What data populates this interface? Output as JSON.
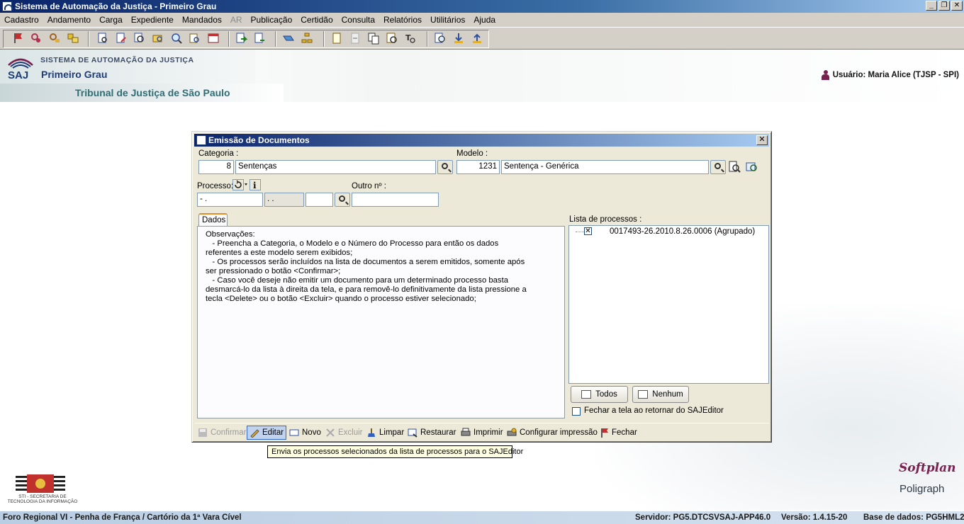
{
  "window": {
    "title": "Sistema de Automação da Justiça - Primeiro Grau",
    "min_glyph": "_",
    "restore_glyph": "❐",
    "close_glyph": "✕"
  },
  "menu": [
    "Cadastro",
    "Andamento",
    "Carga",
    "Expediente",
    "Mandados",
    "AR",
    "Publicação",
    "Certidão",
    "Consulta",
    "Relatórios",
    "Utilitários",
    "Ajuda"
  ],
  "header": {
    "logo_text": "SAJ",
    "system_name": "SISTEMA DE AUTOMAÇÃO DA JUSTIÇA",
    "grau": "Primeiro Grau",
    "tribunal": "Tribunal de Justiça de São Paulo",
    "usuario": "Usuário: Maria Alice (TJSP - SPI)"
  },
  "dialog": {
    "title": "Emissão de Documentos",
    "close_glyph": "✕",
    "categoria": {
      "label": "Categoria :",
      "code": "8",
      "name": "Sentenças"
    },
    "modelo": {
      "label": "Modelo :",
      "code": "1231",
      "name": "Sentença - Genérica"
    },
    "processo": {
      "label": "Processo:",
      "part1": "     -  .",
      "part2": " .  .",
      "part3": ""
    },
    "outro": {
      "label": "Outro nº :",
      "value": ""
    },
    "tab_label": "Dados",
    "observacoes": "Observações:\n   - Preencha a Categoria, o Modelo e o Número do Processo para então os dados\nreferentes a este modelo serem exibidos;\n   - Os processos serão incluídos na lista de documentos a serem emitidos, somente após\nser pressionado o botão <Confirmar>;\n   - Caso você deseje não emitir um documento para um determinado processo basta\ndesmarcá-lo da lista à direita da tela, e para removê-lo definitivamente da lista pressione a\ntecla <Delete> ou o botão <Excluir> quando o processo estiver selecionado;",
    "lista_label": "Lista de processos :",
    "lista_items": [
      {
        "text": "0017493-26.2010.8.26.0006 (Agrupado)",
        "checked": true
      }
    ],
    "check_mark": "✕",
    "btn_todos": "Todos",
    "btn_nenhum": "Nenhum",
    "fechar_check_label": "Fechar a tela ao retornar do SAJEditor",
    "actions": {
      "confirmar": "Confirmar",
      "editar": "Editar",
      "novo": "Novo",
      "excluir": "Excluir",
      "limpar": "Limpar",
      "restaurar": "Restaurar",
      "imprimir": "Imprimir",
      "configurar": "Configurar impressão",
      "fechar": "Fechar"
    },
    "tooltip": "Envia os processos selecionados da lista de processos para o SAJEditor"
  },
  "branding": {
    "sti_text": "STI - SECRETARIA DE TECNOLOGIA DA INFORMAÇÃO",
    "softplan": "Softplan",
    "poligraph": "Poligraph"
  },
  "status": {
    "foro": "Foro Regional VI - Penha de França / Cartório da 1ª Vara Cível",
    "servidor": "Servidor: PG5.DTCSVSAJ-APP46.0",
    "versao": "Versão: 1.4.15-20",
    "base": "Base de dados: PG5HML2"
  },
  "colors": {
    "title_bar": "#0a246a",
    "dialog_bg": "#ece9d8",
    "status_bar": "#b9cde3",
    "tribunal_text": "#2e6e76"
  }
}
